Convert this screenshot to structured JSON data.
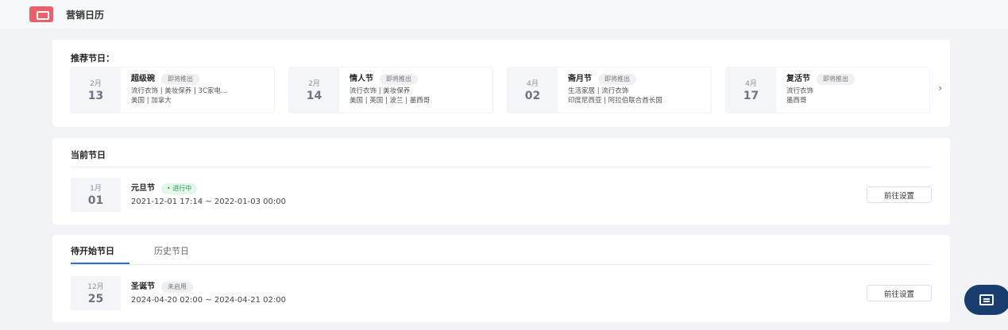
{
  "header": {
    "title": "营销日历"
  },
  "recommended": {
    "title": "推荐节日：",
    "items": [
      {
        "month": "2月",
        "day": "13",
        "name": "超级碗",
        "tag": "即将推出",
        "categories": "流行衣饰 | 美妆保养 | 3C家电...",
        "regions": "美国 | 加拿大"
      },
      {
        "month": "2月",
        "day": "14",
        "name": "情人节",
        "tag": "即将推出",
        "categories": "流行衣饰 | 美妆保养",
        "regions": "美国 | 英国 | 波兰 | 墨西哥"
      },
      {
        "month": "4月",
        "day": "02",
        "name": "斋月节",
        "tag": "即将推出",
        "categories": "生活家居 | 流行衣饰",
        "regions": "印度尼西亚 | 阿拉伯联合酋长国"
      },
      {
        "month": "4月",
        "day": "17",
        "name": "复活节",
        "tag": "即将推出",
        "categories": "流行衣饰",
        "regions": "墨西哥"
      }
    ]
  },
  "current": {
    "title": "当前节日",
    "item": {
      "month": "1月",
      "day": "01",
      "name": "元旦节",
      "status": "• 进行中",
      "time": "2021-12-01 17:14 ~ 2022-01-03 00:00",
      "button": "前往设置"
    }
  },
  "upcoming": {
    "tabs": [
      "待开始节日",
      "历史节日"
    ],
    "item": {
      "month": "12月",
      "day": "25",
      "name": "圣诞节",
      "status": "未启用",
      "time": "2024-04-20 02:00 ~ 2024-04-21 02:00",
      "button": "前往设置"
    }
  }
}
